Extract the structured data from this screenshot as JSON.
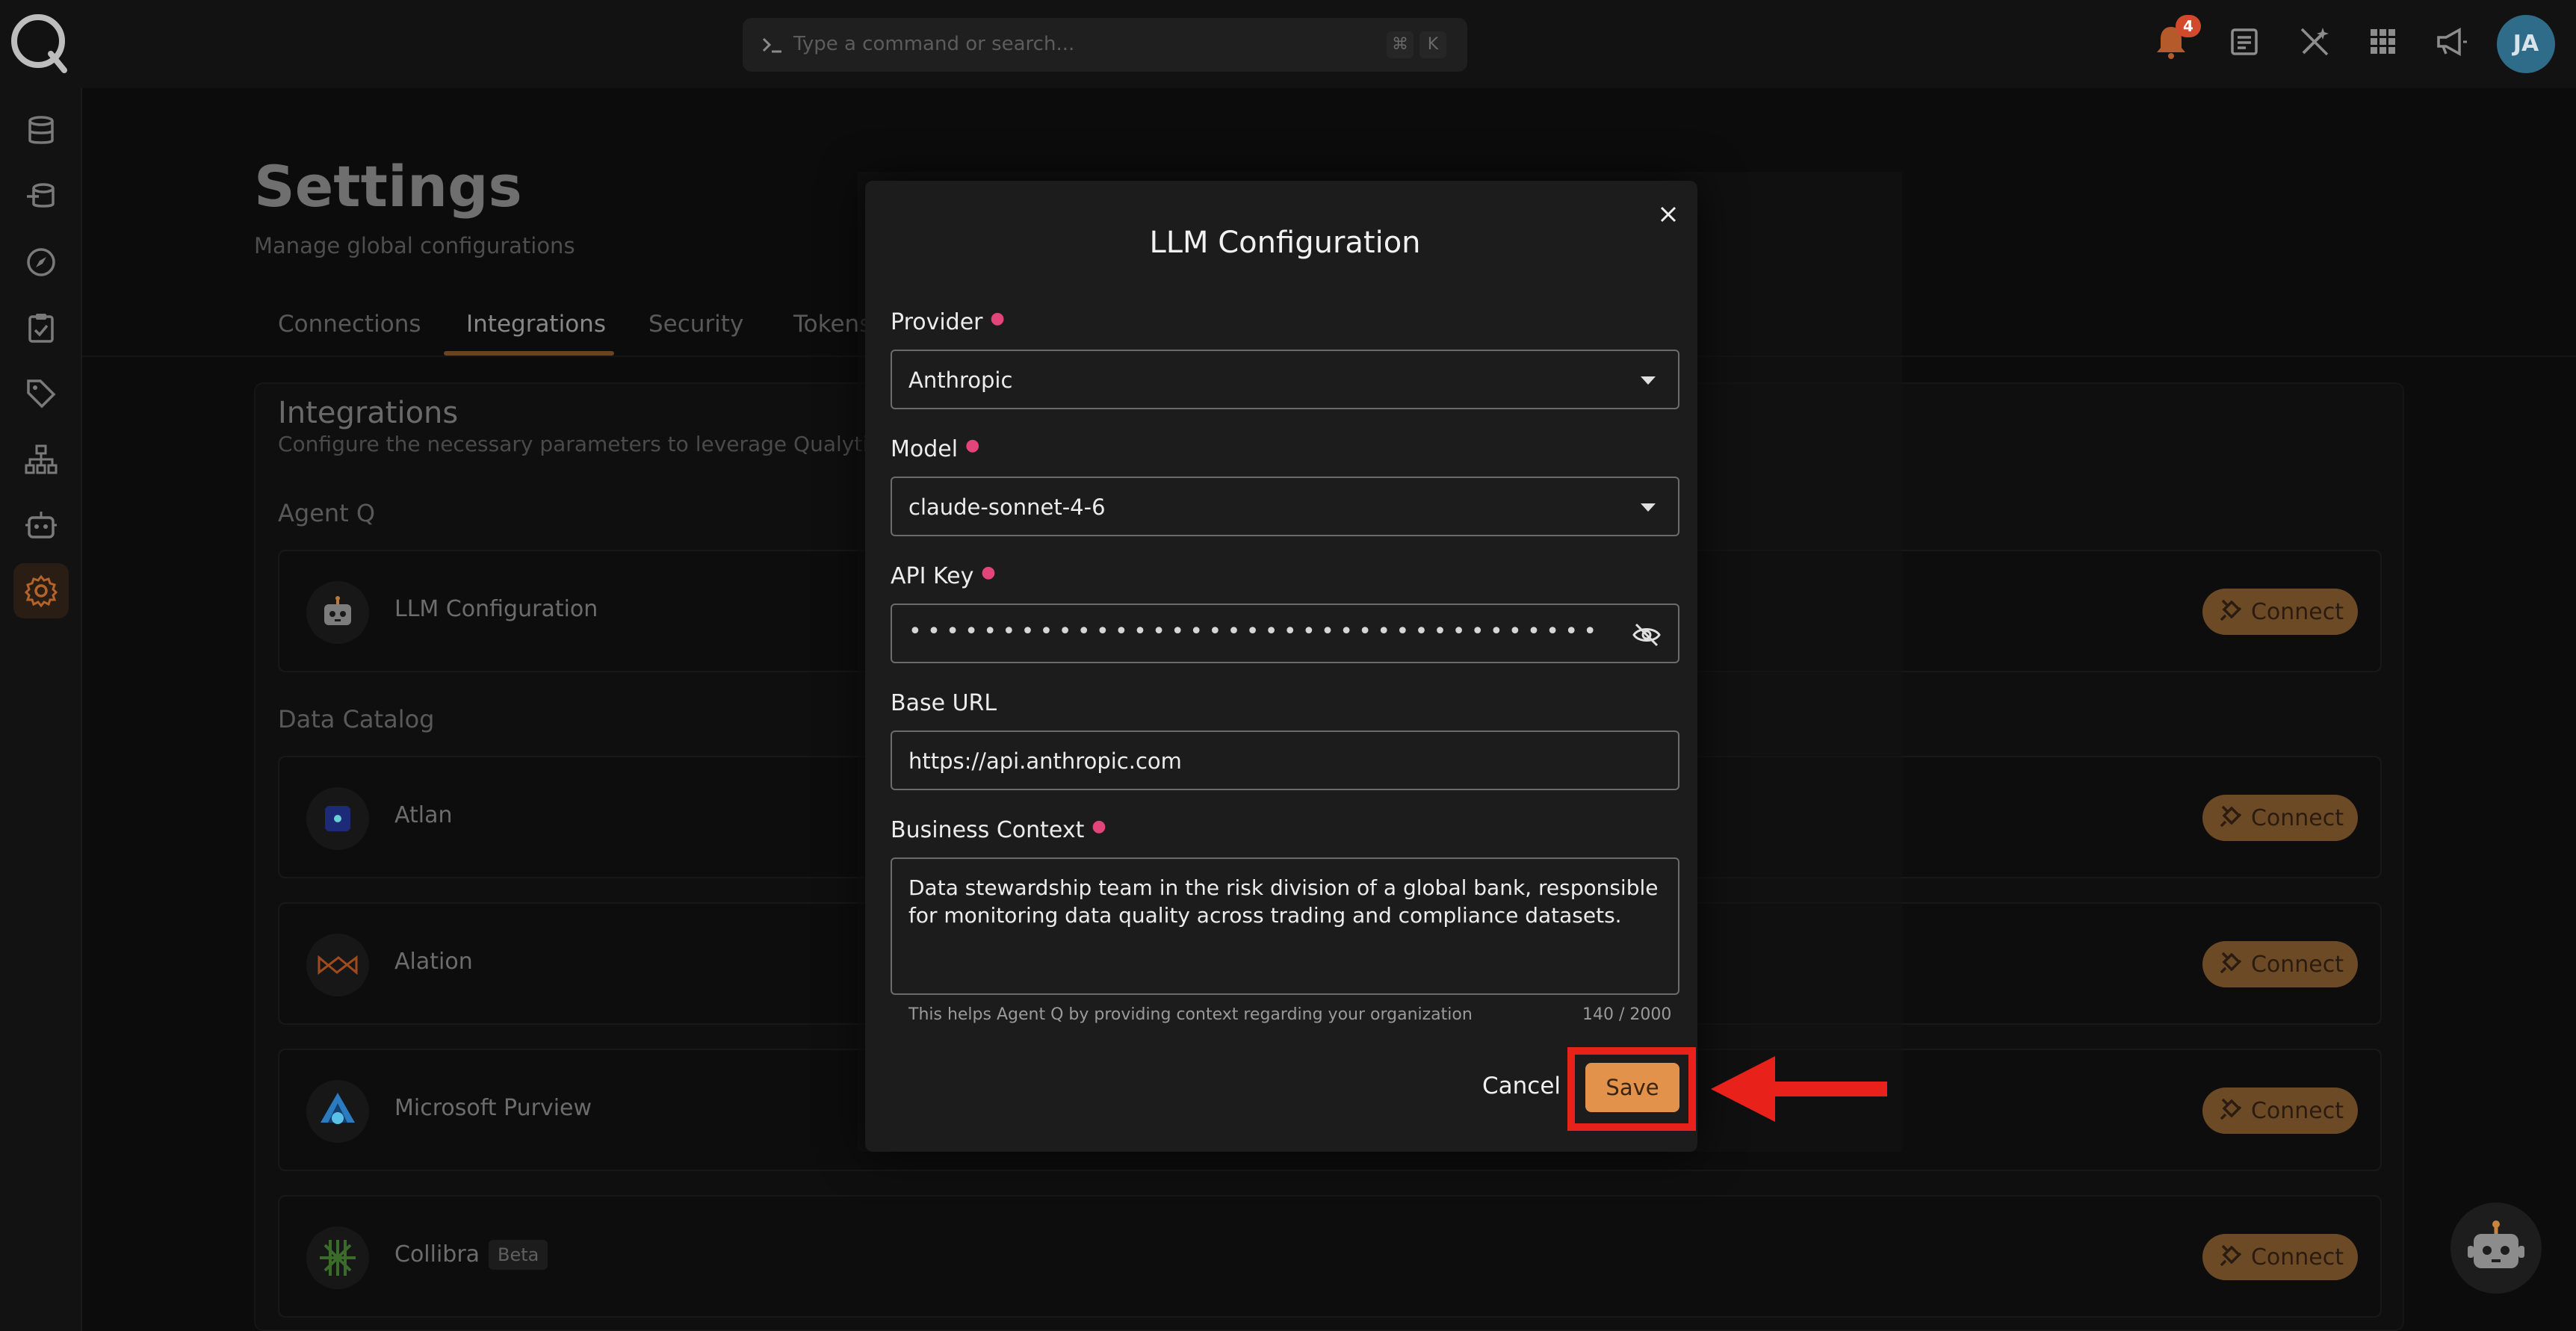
{
  "topbar": {
    "search_placeholder": "Type a command or search...",
    "shortcut_keys": [
      "⌘",
      "K"
    ],
    "notification_count": "4",
    "avatar_initials": "JA"
  },
  "page": {
    "title": "Settings",
    "subtitle": "Manage global configurations",
    "tabs": [
      {
        "label": "Connections"
      },
      {
        "label": "Integrations",
        "active": true
      },
      {
        "label": "Security"
      },
      {
        "label": "Tokens"
      }
    ]
  },
  "integrations": {
    "title": "Integrations",
    "subtitle": "Configure the necessary parameters to leverage Qualytics wi",
    "groups": [
      {
        "label": "Agent Q",
        "items": [
          {
            "name": "LLM Configuration"
          }
        ]
      },
      {
        "label": "Data Catalog",
        "items": [
          {
            "name": "Atlan"
          },
          {
            "name": "Alation"
          },
          {
            "name": "Microsoft Purview"
          },
          {
            "name": "Collibra",
            "badge": "Beta"
          }
        ]
      }
    ],
    "connect_label": "Connect"
  },
  "modal": {
    "title": "LLM Configuration",
    "provider": {
      "label": "Provider",
      "value": "Anthropic"
    },
    "model": {
      "label": "Model",
      "value": "claude-sonnet-4-6"
    },
    "api_key": {
      "label": "API Key",
      "value": "••••••••••••••••••••••••••••••••••••••••••••••••••••"
    },
    "base_url": {
      "label": "Base URL",
      "value": "https://api.anthropic.com"
    },
    "business_context": {
      "label": "Business Context",
      "value": "Data stewardship team in the risk division of a global bank, responsible for monitoring data quality across trading and compliance datasets.",
      "helper": "This helps Agent Q by providing context regarding your organization",
      "counter": "140 / 2000"
    },
    "cancel_label": "Cancel",
    "save_label": "Save"
  },
  "colors": {
    "accent": "#e2924a",
    "required": "#e3447a",
    "highlight": "#e8211a"
  }
}
